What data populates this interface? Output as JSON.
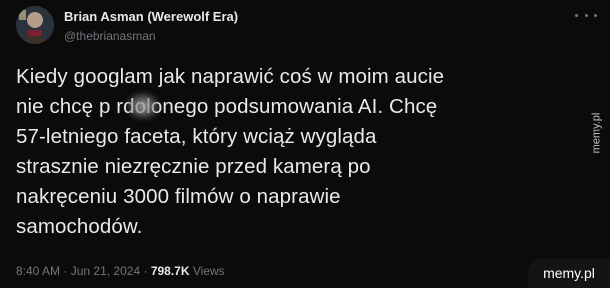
{
  "author": {
    "display_name": "Brian Asman (Werewolf Era)",
    "handle": "@thebrianasman"
  },
  "icons": {
    "more": "more-horizontal-icon",
    "avatar": "user-avatar"
  },
  "post": {
    "text": "Kiedy googlam jak naprawić coś w moim aucie\nnie chcę p   rdolonego podsumowania AI. Chcę\n57-letniego faceta, który wciąż wygląda\nstrasznie niezręcznie przed kamerą po\nnakręceniu 3000 filmów o naprawie\nsamochodów."
  },
  "meta": {
    "time": "8:40 AM",
    "separator_1": "·",
    "date": "Jun 21, 2024",
    "separator_2": "·",
    "views_count": "798.7K",
    "views_label": "Views"
  },
  "watermark": {
    "side_text": "memy.pl",
    "corner_text": "memy.pl"
  },
  "colors": {
    "background": "#0b0b0b",
    "primary_text": "#e7e9ea",
    "secondary_text": "#71767b"
  }
}
